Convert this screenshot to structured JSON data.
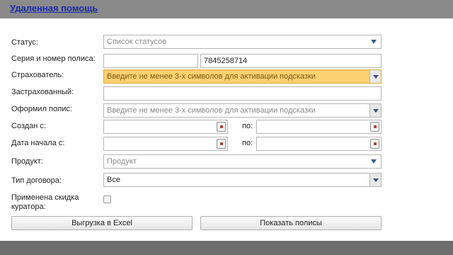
{
  "header": {
    "title": "Удаленная помощь"
  },
  "form": {
    "status": {
      "label": "Статус:",
      "placeholder": "Список статусов"
    },
    "policy": {
      "label": "Серия и номер полиса:",
      "series": "",
      "number": "7845258714"
    },
    "insurer": {
      "label": "Страхователь:",
      "placeholder": "Введите не менее 3-х символов для активации подсказки"
    },
    "insured": {
      "label": "Застрахованный:",
      "value": ""
    },
    "issued_by": {
      "label": "Оформил полис:",
      "placeholder": "Введите не менее 3-х символов для активации подсказки"
    },
    "created": {
      "label": "Создан с:",
      "from": "",
      "to_label": "по:",
      "to": ""
    },
    "start_date": {
      "label": "Дата начала с:",
      "from": "",
      "to_label": "по:",
      "to": ""
    },
    "product": {
      "label": "Продукт:",
      "placeholder": "Продукт"
    },
    "contract_type": {
      "label": "Тип договора:",
      "value": "Все"
    },
    "discount": {
      "label_line1": "Применена скидка",
      "label_line2": "куратора:",
      "checked": false
    }
  },
  "actions": {
    "export_label": "Выгрузка в Excel",
    "show_label": "Показать полисы"
  }
}
